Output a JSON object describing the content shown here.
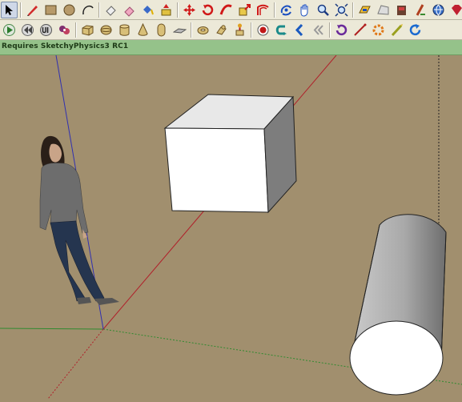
{
  "status_bar": {
    "message": "Requires SketchyPhysics3 RC1"
  },
  "colors": {
    "ground": "#a18f6e",
    "status_bar": "#95c28a",
    "red_axis": "#b0202a",
    "green_axis": "#2f8a2f",
    "blue_axis": "#3030b0"
  },
  "toolbar_top": {
    "icons": [
      "select-icon",
      "pencil-icon",
      "rectangle-icon",
      "circle-icon",
      "arc-icon",
      "eraser-icon",
      "eraser-icon",
      "paint-bucket-icon",
      "push-pull-icon",
      "move-icon",
      "rotate-icon",
      "follow-me-icon",
      "scale-icon",
      "offset-icon",
      "orbit-icon",
      "pan-icon",
      "zoom-icon",
      "zoom-extents-icon",
      "section-plane-icon",
      "sandbox-icon",
      "add-location-icon",
      "measure-icon",
      "3d-warehouse-icon"
    ]
  },
  "toolbar_physics": {
    "icons": [
      "play-icon",
      "rewind-icon",
      "ui-icon",
      "joint-connector-icon",
      "box-solid-icon",
      "sphere-solid-icon",
      "cylinder-solid-icon",
      "cone-solid-icon",
      "capsule-solid-icon",
      "chamfer-solid-icon",
      "wedge-icon",
      "torus-icon",
      "hinge-icon",
      "slider-joint-icon",
      "servo-icon",
      "record-icon",
      "magnet-icon",
      "reset-icon",
      "back-icon",
      "spring-icon",
      "line-joint-icon",
      "gear-joint-icon",
      "piston-icon",
      "refresh-icon"
    ]
  }
}
